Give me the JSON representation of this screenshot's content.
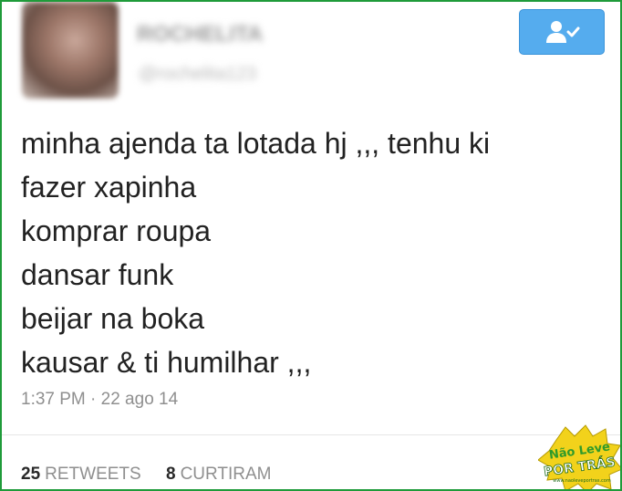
{
  "tweet": {
    "display_name": "ROCHELITA",
    "handle": "@rochelita123",
    "lines": [
      "minha ajenda ta lotada hj ,,, tenhu ki",
      "fazer xapinha",
      "komprar roupa",
      "dansar funk",
      "beijar na boka",
      "kausar & ti humilhar ,,,"
    ],
    "timestamp": "1:37 PM · 22 ago 14"
  },
  "stats": {
    "retweets_count": "25",
    "retweets_label": "RETWEETS",
    "likes_count": "8",
    "likes_label": "CURTIRAM"
  },
  "follow_button": {
    "icon": "follow-user-icon",
    "color": "#55acee"
  },
  "watermark": {
    "line1": "Não Leve",
    "line2": "POR TRÁS",
    "url": "www.naoleveportras.com"
  },
  "colors": {
    "frame_border": "#1f9b3a",
    "text": "#222222",
    "meta": "#8f8f8f"
  }
}
